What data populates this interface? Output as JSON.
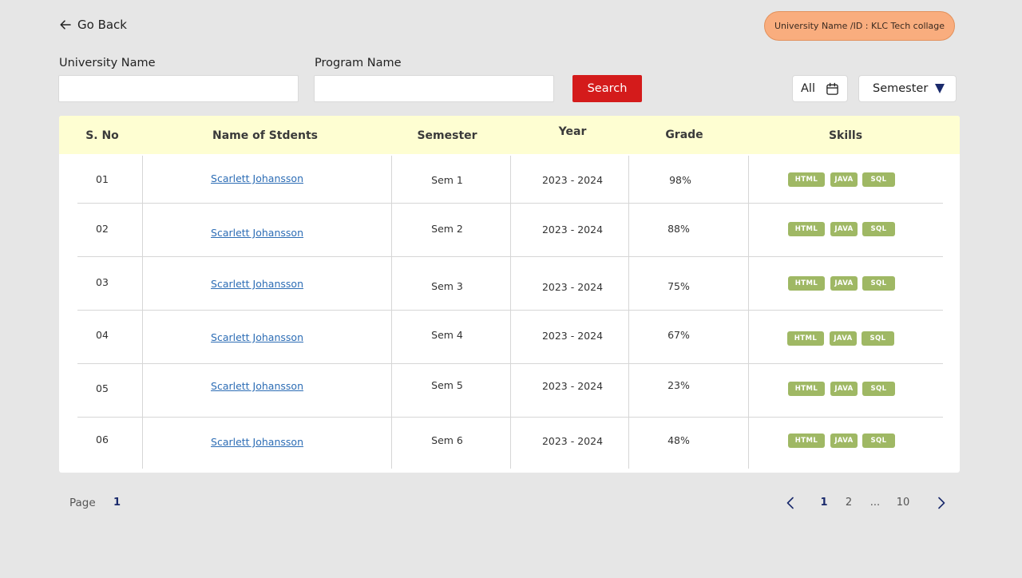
{
  "header": {
    "go_back": "Go Back",
    "university_badge": "University Name /ID : KLC Tech collage"
  },
  "filters": {
    "university_label": "University Name",
    "university_value": "",
    "program_label": "Program Name",
    "program_value": "",
    "search_label": "Search",
    "date_filter": "All",
    "semester_filter": "Semester"
  },
  "table": {
    "headers": [
      "S. No",
      "Name of Stdents",
      "Semester",
      "Year",
      "Grade",
      "Skills"
    ],
    "rows": [
      {
        "sno": "01",
        "name": "Scarlett Johansson",
        "semester": "Sem 1",
        "year": "2023 - 2024",
        "grade": "98%",
        "skills": [
          "HTML",
          "JAVA",
          "SQL"
        ]
      },
      {
        "sno": "02",
        "name": "Scarlett Johansson",
        "semester": "Sem 2",
        "year": "2023 - 2024",
        "grade": "88%",
        "skills": [
          "HTML",
          "JAVA",
          "SQL"
        ]
      },
      {
        "sno": "03",
        "name": "Scarlett Johansson",
        "semester": "Sem 3",
        "year": "2023 - 2024",
        "grade": "75%",
        "skills": [
          "HTML",
          "JAVA",
          "SQL"
        ]
      },
      {
        "sno": "04",
        "name": "Scarlett Johansson",
        "semester": "Sem 4",
        "year": "2023 - 2024",
        "grade": "67%",
        "skills": [
          "HTML",
          "JAVA",
          "SQL"
        ]
      },
      {
        "sno": "05",
        "name": "Scarlett Johansson",
        "semester": "Sem 5",
        "year": "2023 - 2024",
        "grade": "23%",
        "skills": [
          "HTML",
          "JAVA",
          "SQL"
        ]
      },
      {
        "sno": "06",
        "name": "Scarlett Johansson",
        "semester": "Sem 6",
        "year": "2023 - 2024",
        "grade": "48%",
        "skills": [
          "HTML",
          "JAVA",
          "SQL"
        ]
      }
    ]
  },
  "pagination": {
    "page_label": "Page",
    "current_page": "1",
    "pages": [
      "1",
      "2",
      "...",
      "10"
    ]
  },
  "colors": {
    "accent_button": "#d41b1b",
    "badge": "#f9ad7e",
    "table_header": "#fefed2",
    "skill_tag": "#9fb864",
    "link": "#2d6db5"
  }
}
